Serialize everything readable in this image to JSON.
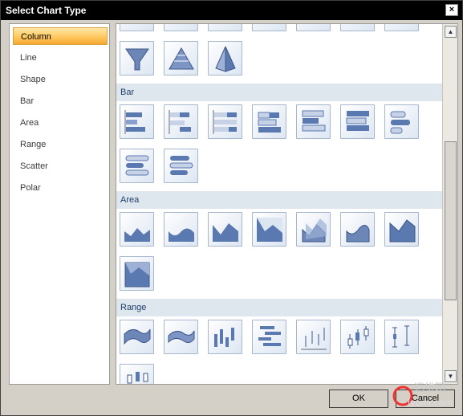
{
  "window": {
    "title": "Select Chart Type",
    "close_glyph": "×"
  },
  "categories": [
    {
      "label": "Column",
      "selected": true
    },
    {
      "label": "Line",
      "selected": false
    },
    {
      "label": "Shape",
      "selected": false
    },
    {
      "label": "Bar",
      "selected": false
    },
    {
      "label": "Area",
      "selected": false
    },
    {
      "label": "Range",
      "selected": false
    },
    {
      "label": "Scatter",
      "selected": false
    },
    {
      "label": "Polar",
      "selected": false
    }
  ],
  "groups": [
    {
      "title": "Bar",
      "tiles": [
        "bar-stacked-icon",
        "bar-clustered-icon",
        "bar-100-icon",
        "bar-3d-stacked-icon",
        "bar-3d-clustered-icon",
        "bar-3d-100-icon",
        "bar-cylinder-icon",
        "bar-cylinder-stacked-icon",
        "bar-cylinder-100-icon"
      ]
    },
    {
      "title": "Area",
      "tiles": [
        "area-icon",
        "area-smooth-icon",
        "area-stacked-icon",
        "area-100-icon",
        "area-3d-icon",
        "area-3d-smooth-icon",
        "area-3d-stacked-icon",
        "area-3d-100-icon"
      ]
    },
    {
      "title": "Range",
      "tiles": [
        "range-area-icon",
        "range-spline-icon",
        "range-column-icon",
        "range-bar-icon",
        "stock-hlc-icon",
        "candlestick-icon",
        "errorbar-icon",
        "boxplot-icon"
      ]
    }
  ],
  "top_tiles": [
    "funnel-icon",
    "pyramid-icon",
    "pyramid-3d-icon"
  ],
  "buttons": {
    "ok": "OK",
    "cancel": "Cancel"
  },
  "watermark": {
    "line1": "运维网",
    "line2": "iyunv.com"
  },
  "colors": {
    "selection": "#ffc860",
    "group_header": "#dfe7ee",
    "tile_blue": "#5b79b1"
  }
}
